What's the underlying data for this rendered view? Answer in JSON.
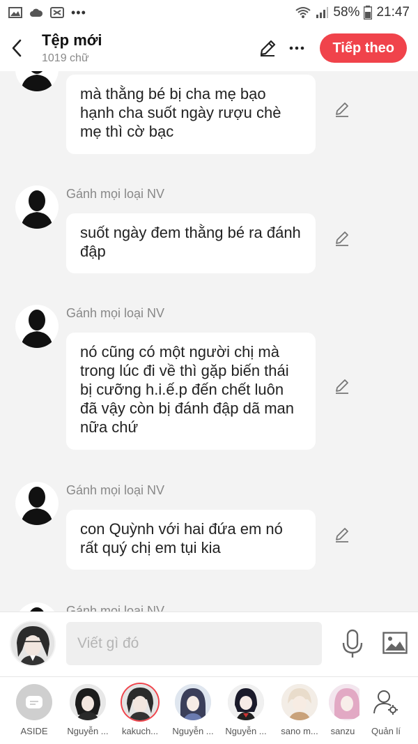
{
  "statusbar": {
    "battery": "58%",
    "time": "21:47"
  },
  "header": {
    "title": "Tệp mới",
    "word_count": "1019 chữ",
    "next_label": "Tiếp theo"
  },
  "messages": [
    {
      "sender": "",
      "text": "mà thằng bé bị cha mẹ bạo hạnh cha suốt ngày rượu chè mẹ thì cờ bạc"
    },
    {
      "sender": "Gánh mọi loại NV",
      "text": "suốt ngày đem thằng bé ra đánh đập"
    },
    {
      "sender": "Gánh mọi loại NV",
      "text": "nó cũng có một người chị mà trong lúc đi về thì gặp biến thái bị cưỡng h.i.ế.p đến chết luôn đã vậy còn bị đánh đập dã man nữa chứ"
    },
    {
      "sender": "Gánh mọi loại NV",
      "text": "con Quỳnh với hai đứa em nó rất quý chị em tụi kia"
    },
    {
      "sender": "Gánh mọi loại NV",
      "text": ""
    }
  ],
  "composer": {
    "placeholder": "Viết gì đó"
  },
  "characters": [
    {
      "name": "ASIDE"
    },
    {
      "name": "Nguyễn ..."
    },
    {
      "name": "kakuch..."
    },
    {
      "name": "Nguyễn ..."
    },
    {
      "name": "Nguyễn ..."
    },
    {
      "name": "sano m..."
    },
    {
      "name": "sanzu"
    },
    {
      "name": "Quản lí"
    }
  ],
  "colors": {
    "accent": "#f0434b",
    "background": "#f3f3f3",
    "bubble": "#ffffff"
  }
}
